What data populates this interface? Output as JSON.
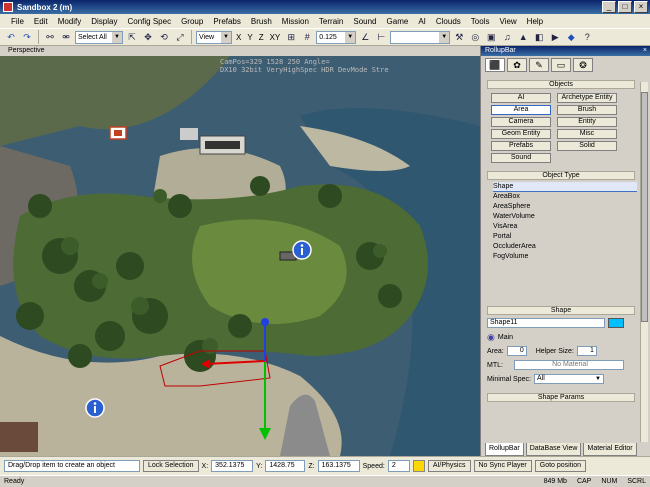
{
  "window": {
    "title": "Sandbox 2 (m)"
  },
  "menu": [
    "File",
    "Edit",
    "Modify",
    "Display",
    "Config Spec",
    "Group",
    "Prefabs",
    "Brush",
    "Mission",
    "Terrain",
    "Sound",
    "Game",
    "AI",
    "Clouds",
    "Tools",
    "View",
    "Help"
  ],
  "toolbar": {
    "selection_combo": "Select All",
    "coord_combo": "View",
    "axis_x": "X",
    "axis_y": "Y",
    "axis_z": "Z",
    "axis_xy": "XY",
    "snap_value": "0.125"
  },
  "viewport": {
    "label": "Perspective",
    "hud_line1": "CamPos=329 1528 250 Angle=",
    "hud_line2": "DX10 32bit VeryHighSpec HDR DevMode Stre"
  },
  "rollup": {
    "title": "RollupBar",
    "sections": {
      "objects": "Objects",
      "object_type": "Object Type",
      "shape": "Shape",
      "shape_params": "Shape Params"
    },
    "object_buttons": [
      "AI",
      "Archetype Entity",
      "Area",
      "Brush",
      "Camera",
      "Entity",
      "Geom Entity",
      "Misc",
      "Prefabs",
      "Solid",
      "Sound"
    ],
    "object_types": [
      "Shape",
      "AreaBox",
      "AreaSphere",
      "WaterVolume",
      "VisArea",
      "Portal",
      "OccluderArea",
      "FogVolume"
    ],
    "shape_name": "Shape11",
    "shape_color": "#00bfff",
    "layer": "Main",
    "area_label": "Area:",
    "area_value": "0",
    "height_label": "Helper Size:",
    "height_value": "1",
    "mtl_label": "MTL:",
    "mtl_value": "No Material",
    "minspec_label": "Minimal Spec:",
    "minspec_value": "All",
    "bottom_tabs": [
      "RollupBar",
      "DataBase View",
      "Material Editor"
    ]
  },
  "status": {
    "hint": "Drag/Drop item to create an object",
    "lock_selection": "Lock Selection",
    "x_label": "X:",
    "x_value": "352.1375",
    "y_label": "Y:",
    "y_value": "1428.75",
    "z_label": "Z:",
    "z_value": "163.1375",
    "speed_label": "Speed:",
    "speed_value": "2",
    "ai_physics": "AI/Physics",
    "no_sync": "No Sync Player",
    "goto_pos": "Goto position",
    "ready": "Ready",
    "mem": "849 Mb",
    "cap": "CAP",
    "num": "NUM",
    "scrl": "SCRL"
  }
}
